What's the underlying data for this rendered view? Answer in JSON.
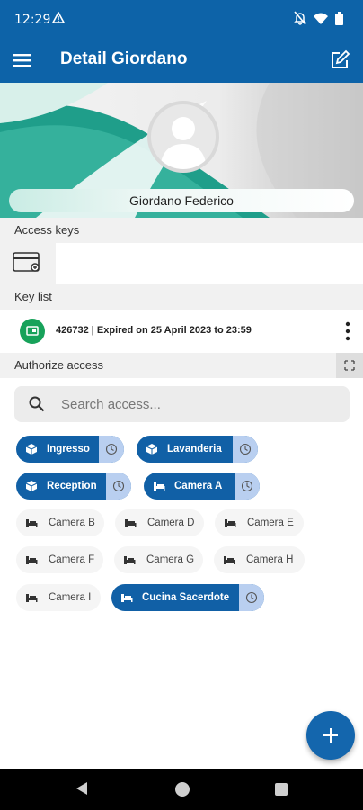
{
  "status_bar": {
    "time": "12:29"
  },
  "app_bar": {
    "title": "Detail Giordano"
  },
  "profile": {
    "name": "Giordano Federico"
  },
  "sections": {
    "access_keys": "Access keys",
    "key_list": "Key list",
    "authorize_access": "Authorize access"
  },
  "key_list": [
    {
      "text": "426732 | Expired on 25 April 2023 to 23:59"
    }
  ],
  "search": {
    "placeholder": "Search access..."
  },
  "chips": [
    {
      "label": "Ingresso",
      "active": true,
      "icon": "cube-icon"
    },
    {
      "label": "Lavanderia",
      "active": true,
      "icon": "cube-icon"
    },
    {
      "label": "Reception",
      "active": true,
      "icon": "cube-icon"
    },
    {
      "label": "Camera A",
      "active": true,
      "icon": "bed-icon"
    },
    {
      "label": "Camera B",
      "active": false,
      "icon": "bed-icon"
    },
    {
      "label": "Camera D",
      "active": false,
      "icon": "bed-icon"
    },
    {
      "label": "Camera E",
      "active": false,
      "icon": "bed-icon"
    },
    {
      "label": "Camera F",
      "active": false,
      "icon": "bed-icon"
    },
    {
      "label": "Camera G",
      "active": false,
      "icon": "bed-icon"
    },
    {
      "label": "Camera H",
      "active": false,
      "icon": "bed-icon"
    },
    {
      "label": "Camera I",
      "active": false,
      "icon": "bed-icon"
    },
    {
      "label": "Cucina Sacerdote",
      "active": true,
      "icon": "bed-icon"
    }
  ],
  "colors": {
    "primary": "#0d63a8",
    "chip_active": "#1160a6",
    "chip_clock": "#b9cff0",
    "key_badge": "#17a25a",
    "banner_teal": "#1f9e8a"
  }
}
